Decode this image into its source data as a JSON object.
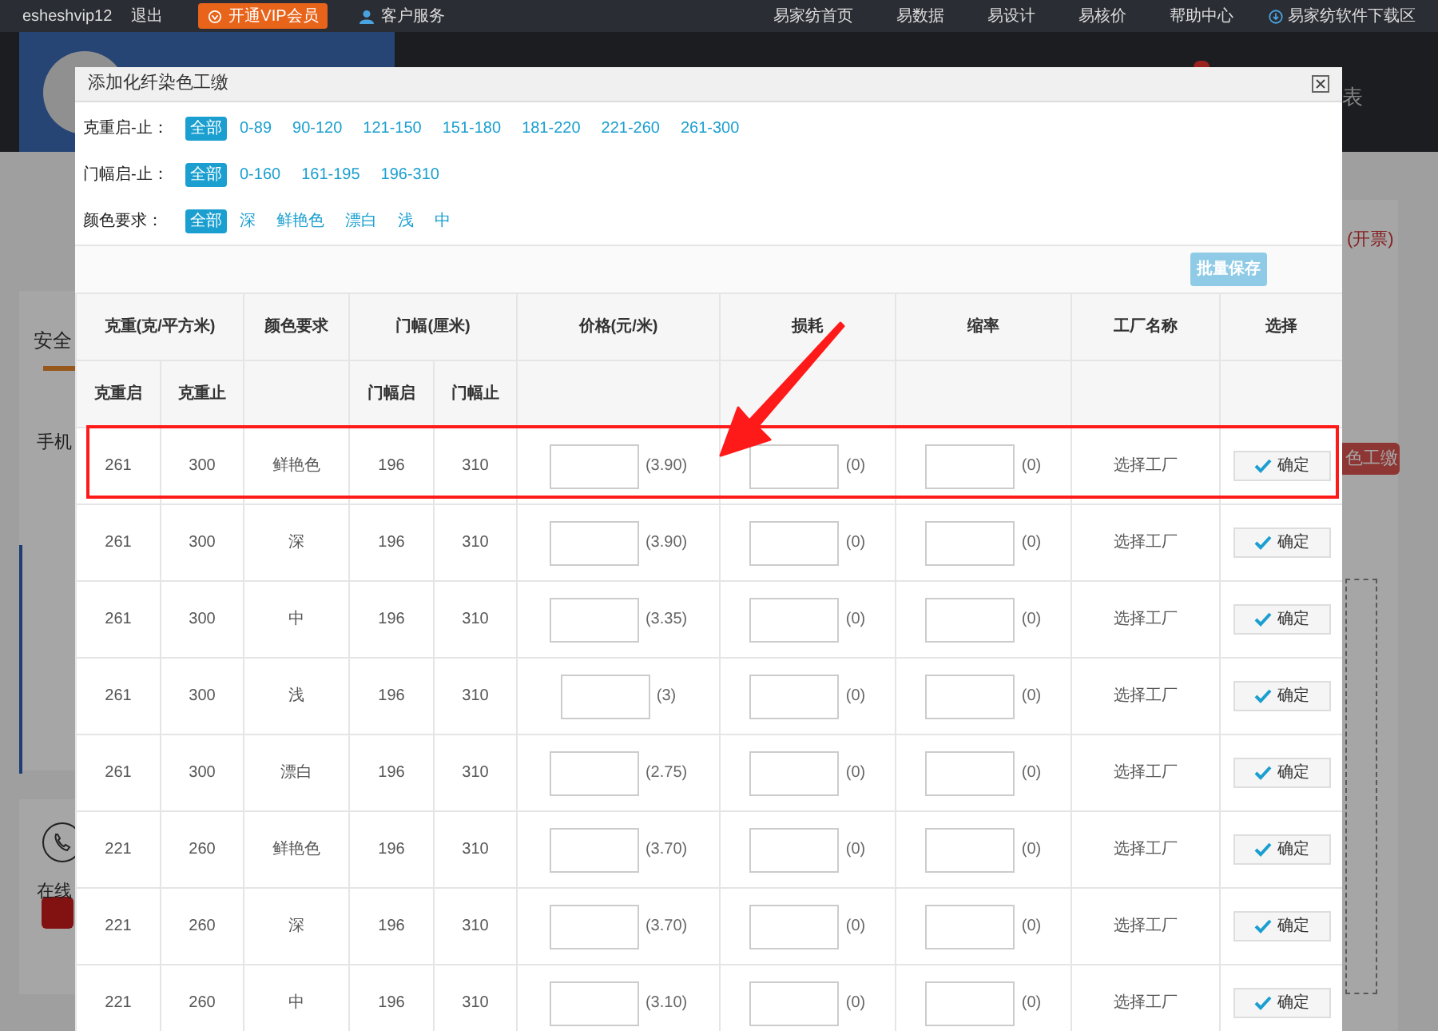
{
  "top_bar": {
    "username": "esheshvip12",
    "logout": "退出",
    "vip_button": "开通VIP会员",
    "service": "客户服务",
    "nav": [
      "易家纺首页",
      "易数据",
      "易设计",
      "易核价",
      "帮助中心"
    ],
    "download": "易家纺软件下载区"
  },
  "background_page": {
    "menu_fragment": "表",
    "tab_fragment": "安全",
    "phone_fragment": "手机",
    "online_fragment": "在线",
    "invoice_fragment": "(开票)",
    "button_fragment": "色工缴"
  },
  "dialog": {
    "title": "添加化纤染色工缴",
    "filters": [
      {
        "label": "克重启-止：",
        "options": [
          {
            "text": "全部",
            "selected": true
          },
          {
            "text": "0-89",
            "selected": false
          },
          {
            "text": "90-120",
            "selected": false
          },
          {
            "text": "121-150",
            "selected": false
          },
          {
            "text": "151-180",
            "selected": false
          },
          {
            "text": "181-220",
            "selected": false
          },
          {
            "text": "221-260",
            "selected": false
          },
          {
            "text": "261-300",
            "selected": false
          }
        ]
      },
      {
        "label": "门幅启-止：",
        "options": [
          {
            "text": "全部",
            "selected": true
          },
          {
            "text": "0-160",
            "selected": false
          },
          {
            "text": "161-195",
            "selected": false
          },
          {
            "text": "196-310",
            "selected": false
          }
        ]
      },
      {
        "label": "颜色要求：",
        "options": [
          {
            "text": "全部",
            "selected": true
          },
          {
            "text": "深",
            "selected": false
          },
          {
            "text": "鲜艳色",
            "selected": false
          },
          {
            "text": "漂白",
            "selected": false
          },
          {
            "text": "浅",
            "selected": false
          },
          {
            "text": "中",
            "selected": false
          }
        ]
      }
    ],
    "batch_save": "批量保存",
    "table": {
      "group_headers": [
        "克重(克/平方米)",
        "颜色要求",
        "门幅(厘米)",
        "价格(元/米)",
        "损耗",
        "缩率",
        "工厂名称",
        "选择"
      ],
      "sub_headers": [
        "克重启",
        "克重止",
        "门幅启",
        "门幅止"
      ],
      "rows": [
        {
          "weight_from": "261",
          "weight_to": "300",
          "color_requirement": "鲜艳色",
          "width_from": "196",
          "width_to": "310",
          "price_hint": "(3.90)",
          "loss_hint": "(0)",
          "shrink_hint": "(0)",
          "factory": "选择工厂",
          "confirm": "确定",
          "highlighted": true
        },
        {
          "weight_from": "261",
          "weight_to": "300",
          "color_requirement": "深",
          "width_from": "196",
          "width_to": "310",
          "price_hint": "(3.90)",
          "loss_hint": "(0)",
          "shrink_hint": "(0)",
          "factory": "选择工厂",
          "confirm": "确定",
          "highlighted": false
        },
        {
          "weight_from": "261",
          "weight_to": "300",
          "color_requirement": "中",
          "width_from": "196",
          "width_to": "310",
          "price_hint": "(3.35)",
          "loss_hint": "(0)",
          "shrink_hint": "(0)",
          "factory": "选择工厂",
          "confirm": "确定",
          "highlighted": false
        },
        {
          "weight_from": "261",
          "weight_to": "300",
          "color_requirement": "浅",
          "width_from": "196",
          "width_to": "310",
          "price_hint": "(3)",
          "loss_hint": "(0)",
          "shrink_hint": "(0)",
          "factory": "选择工厂",
          "confirm": "确定",
          "highlighted": false
        },
        {
          "weight_from": "261",
          "weight_to": "300",
          "color_requirement": "漂白",
          "width_from": "196",
          "width_to": "310",
          "price_hint": "(2.75)",
          "loss_hint": "(0)",
          "shrink_hint": "(0)",
          "factory": "选择工厂",
          "confirm": "确定",
          "highlighted": false
        },
        {
          "weight_from": "221",
          "weight_to": "260",
          "color_requirement": "鲜艳色",
          "width_from": "196",
          "width_to": "310",
          "price_hint": "(3.70)",
          "loss_hint": "(0)",
          "shrink_hint": "(0)",
          "factory": "选择工厂",
          "confirm": "确定",
          "highlighted": false
        },
        {
          "weight_from": "221",
          "weight_to": "260",
          "color_requirement": "深",
          "width_from": "196",
          "width_to": "310",
          "price_hint": "(3.70)",
          "loss_hint": "(0)",
          "shrink_hint": "(0)",
          "factory": "选择工厂",
          "confirm": "确定",
          "highlighted": false
        },
        {
          "weight_from": "221",
          "weight_to": "260",
          "color_requirement": "中",
          "width_from": "196",
          "width_to": "310",
          "price_hint": "(3.10)",
          "loss_hint": "(0)",
          "shrink_hint": "(0)",
          "factory": "选择工厂",
          "confirm": "确定",
          "highlighted": false
        }
      ]
    }
  }
}
